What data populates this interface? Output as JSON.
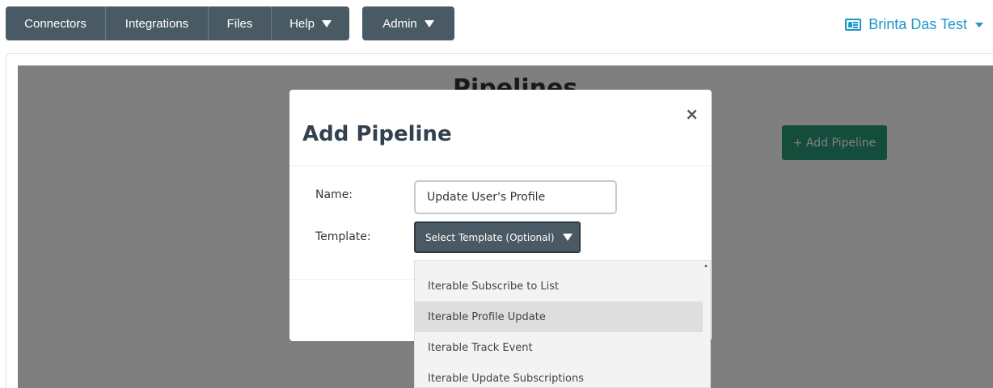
{
  "nav": {
    "items": [
      {
        "label": "Connectors"
      },
      {
        "label": "Integrations"
      },
      {
        "label": "Files"
      },
      {
        "label": "Help"
      }
    ],
    "admin_label": "Admin"
  },
  "user": {
    "name": "Brinta Das Test"
  },
  "page": {
    "title": "Pipelines",
    "add_button": "+ Add Pipeline"
  },
  "modal": {
    "title": "Add Pipeline",
    "close_symbol": "×",
    "name_label": "Name:",
    "name_value": "Update User's Profile",
    "template_label": "Template:",
    "template_placeholder": "Select Template (Optional)"
  },
  "dropdown": {
    "options": [
      {
        "label": "Iterable Subscribe to List"
      },
      {
        "label": "Iterable Profile Update"
      },
      {
        "label": "Iterable Track Event"
      },
      {
        "label": "Iterable Update Subscriptions"
      }
    ],
    "highlighted_index": 1
  },
  "colors": {
    "nav_bg": "#4a5a64",
    "link_blue": "#1e96c8",
    "primary_green": "#2a9a7a"
  }
}
